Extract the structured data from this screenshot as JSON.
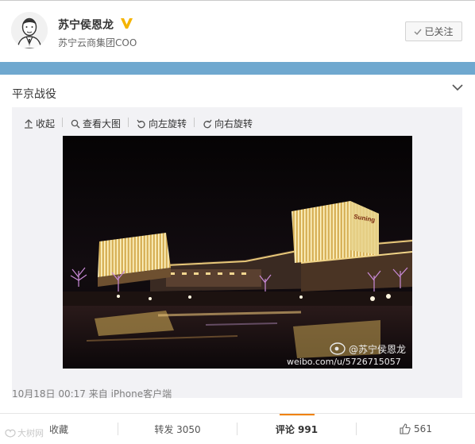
{
  "user": {
    "name": "苏宁侯恩龙",
    "title": "苏宁云商集团COO",
    "follow_label": "已关注"
  },
  "post": {
    "text": "平京战役",
    "toolbar": {
      "collapse": "收起",
      "view_large": "查看大图",
      "rotate_left": "向左旋转",
      "rotate_right": "向右旋转"
    },
    "photo": {
      "sign_text": "Suning",
      "watermark_name": "@苏宁侯恩龙",
      "watermark_url": "weibo.com/u/5726715057"
    },
    "meta": "10月18日 00:17 来自 iPhone客户端"
  },
  "footer": {
    "favorite": "收藏",
    "repost": "转发 3050",
    "comment": "评论 991",
    "like": "561"
  },
  "site_watermark": "大树网"
}
